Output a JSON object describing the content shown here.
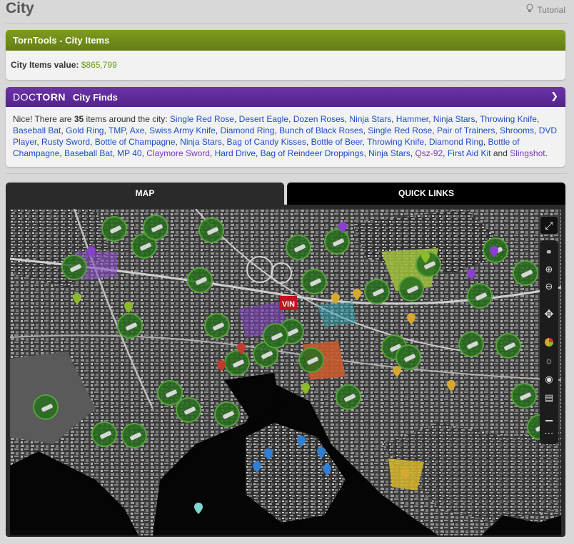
{
  "page": {
    "title": "City",
    "tutorial_label": "Tutorial"
  },
  "torntools": {
    "header": "TornTools - City Items",
    "value_label": "City Items value:",
    "value": "$865,799"
  },
  "doctorn": {
    "logo_doc": "DOC",
    "logo_torn": "TORN",
    "header": "City Finds",
    "intro_prefix": "Nice! There are ",
    "count": "35",
    "intro_suffix": " items around the city: ",
    "items": [
      {
        "name": "Single Red Rose",
        "rare": false
      },
      {
        "name": "Desert Eagle",
        "rare": false
      },
      {
        "name": "Dozen Roses",
        "rare": false
      },
      {
        "name": "Ninja Stars",
        "rare": false
      },
      {
        "name": "Hammer",
        "rare": false
      },
      {
        "name": "Ninja Stars",
        "rare": false
      },
      {
        "name": "Throwing Knife",
        "rare": false
      },
      {
        "name": "Baseball Bat",
        "rare": false
      },
      {
        "name": "Gold Ring",
        "rare": false
      },
      {
        "name": "TMP",
        "rare": false
      },
      {
        "name": "Axe",
        "rare": false
      },
      {
        "name": "Swiss Army Knife",
        "rare": false
      },
      {
        "name": "Diamond Ring",
        "rare": false
      },
      {
        "name": "Bunch of Black Roses",
        "rare": false
      },
      {
        "name": "Single Red Rose",
        "rare": false
      },
      {
        "name": "Pair of Trainers",
        "rare": false
      },
      {
        "name": "Shrooms",
        "rare": false
      },
      {
        "name": "DVD Player",
        "rare": false
      },
      {
        "name": "Rusty Sword",
        "rare": false
      },
      {
        "name": "Bottle of Champagne",
        "rare": false
      },
      {
        "name": "Ninja Stars",
        "rare": false
      },
      {
        "name": "Bag of Candy Kisses",
        "rare": false
      },
      {
        "name": "Bottle of Beer",
        "rare": false
      },
      {
        "name": "Throwing Knife",
        "rare": false
      },
      {
        "name": "Diamond Ring",
        "rare": false
      },
      {
        "name": "Bottle of Champagne",
        "rare": false
      },
      {
        "name": "Baseball Bat",
        "rare": false
      },
      {
        "name": "MP 40",
        "rare": false
      },
      {
        "name": "Claymore Sword",
        "rare": true
      },
      {
        "name": "Hard Drive",
        "rare": false
      },
      {
        "name": "Bag of Reindeer Droppings",
        "rare": false
      },
      {
        "name": "Ninja Stars",
        "rare": false
      },
      {
        "name": "Qsz-92",
        "rare": true
      },
      {
        "name": "First Aid Kit",
        "rare": false
      },
      {
        "name": "Slingshot",
        "rare": true
      }
    ],
    "conjunction": " and ",
    "ending": "."
  },
  "tabs": [
    {
      "label": "MAP",
      "active": true
    },
    {
      "label": "QUICK LINKS",
      "active": false
    }
  ],
  "map": {
    "vin_label": "ViN",
    "controls": [
      "expand-icon",
      "link-icon",
      "zoom-in-icon",
      "zoom-out-icon",
      "pan-icon",
      "color-wheel-icon",
      "brightness-icon",
      "target-icon",
      "layers-icon",
      "dots-icon"
    ]
  },
  "colors": {
    "torntools_green": "#6e8a18",
    "doctorn_purple": "#5e2897",
    "link_blue": "#1a4ec9",
    "rare_purple": "#7b3ab8",
    "value_green": "#6a9a14"
  }
}
